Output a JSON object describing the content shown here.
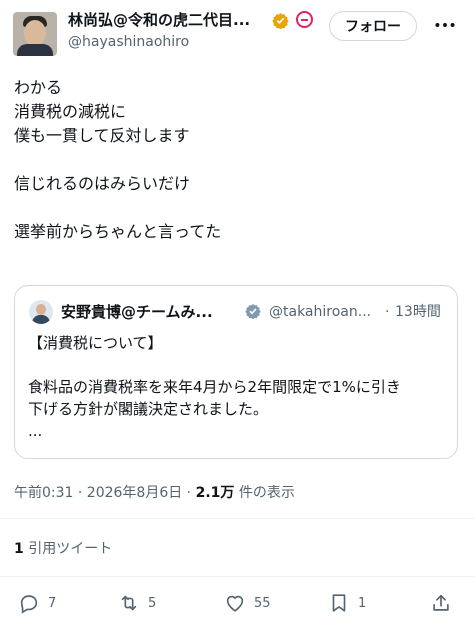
{
  "author": {
    "display_name": "林尚弘@令和の虎二代目...",
    "handle": "@hayashinaohiro",
    "follow_label": "フォロー"
  },
  "tweet": {
    "lines": [
      "わかる",
      "消費税の減税に",
      "僕も一貫して反対します",
      "",
      "信じれるのはみらいだけ",
      "",
      "選挙前からちゃんと言ってた"
    ]
  },
  "quote": {
    "display_name": "安野貴博@チームみ...",
    "handle": "@takahiroan...",
    "separator": "·",
    "time": "13時間",
    "lines": [
      "【消費税について】",
      "",
      "食料品の消費税率を来年4月から2年間限定で1%に引き",
      "下げる方針が閣議決定されました。",
      "..."
    ]
  },
  "meta": {
    "timestamp": "午前0:31 · 2026年8月6日 · ",
    "views_count": "2.1万",
    "views_label": " 件の表示"
  },
  "quote_tweets": {
    "count": "1",
    "label": " 引用ツイート"
  },
  "actions": {
    "replies": "7",
    "retweets": "5",
    "likes": "55",
    "bookmarks": "1"
  },
  "colors": {
    "verified_gold": "#e8a400",
    "muted": "#536471",
    "border": "#cfd9de"
  }
}
